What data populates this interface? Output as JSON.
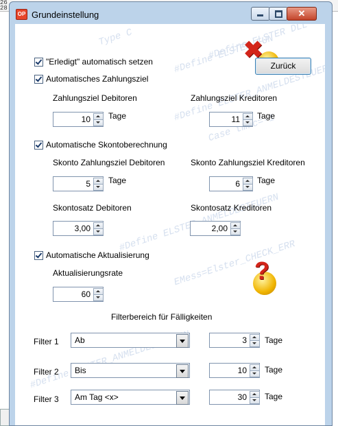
{
  "background": {
    "num1": "26",
    "num2": "28"
  },
  "window": {
    "title": "Grundeinstellung",
    "close_symbol": "✕",
    "app_icon_text": "OP"
  },
  "back_button": {
    "label": "Zurück"
  },
  "done_checkbox": {
    "label": "\"Erledigt\" automatisch setzen"
  },
  "payment_terms": {
    "checkbox_label": "Automatisches Zahlungsziel",
    "debtors_label": "Zahlungsziel Debitoren",
    "creditors_label": "Zahlungsziel Kreditoren",
    "debtors_value": "10",
    "creditors_value": "11",
    "unit": "Tage"
  },
  "discount": {
    "checkbox_label": "Automatische Skontoberechnung",
    "term_debtors_label": "Skonto Zahlungsziel Debitoren",
    "term_creditors_label": "Skonto Zahlungsziel Kreditoren",
    "term_debtors_value": "5",
    "term_creditors_value": "6",
    "unit": "Tage",
    "rate_debtors_label": "Skontosatz Debitoren",
    "rate_creditors_label": "Skontosatz Kreditoren",
    "rate_debtors_value": "3,00",
    "rate_creditors_value": "2,00"
  },
  "update": {
    "checkbox_label": "Automatische Aktualisierung",
    "rate_label": "Aktualisierungsrate",
    "rate_value": "60"
  },
  "filters": {
    "heading": "Filterbereich für Fälligkeiten",
    "unit": "Tage",
    "rows": [
      {
        "label": "Filter 1",
        "mode": "Ab",
        "days": "3"
      },
      {
        "label": "Filter 2",
        "mode": "Bis",
        "days": "10"
      },
      {
        "label": "Filter 3",
        "mode": "Am Tag <x>",
        "days": "30"
      }
    ]
  },
  "watermark_lines": [
    "#Define ELSTER_FUN",
    "#Define ELSTER DLL",
    "#Define ELSTER_ANMELDESTEUERN",
    "Case tmrc=-1",
    "EMess=Elster_CHECK_ERR",
    "Type C",
    "#Define ELSTER_ANMELDESTEUERN"
  ]
}
